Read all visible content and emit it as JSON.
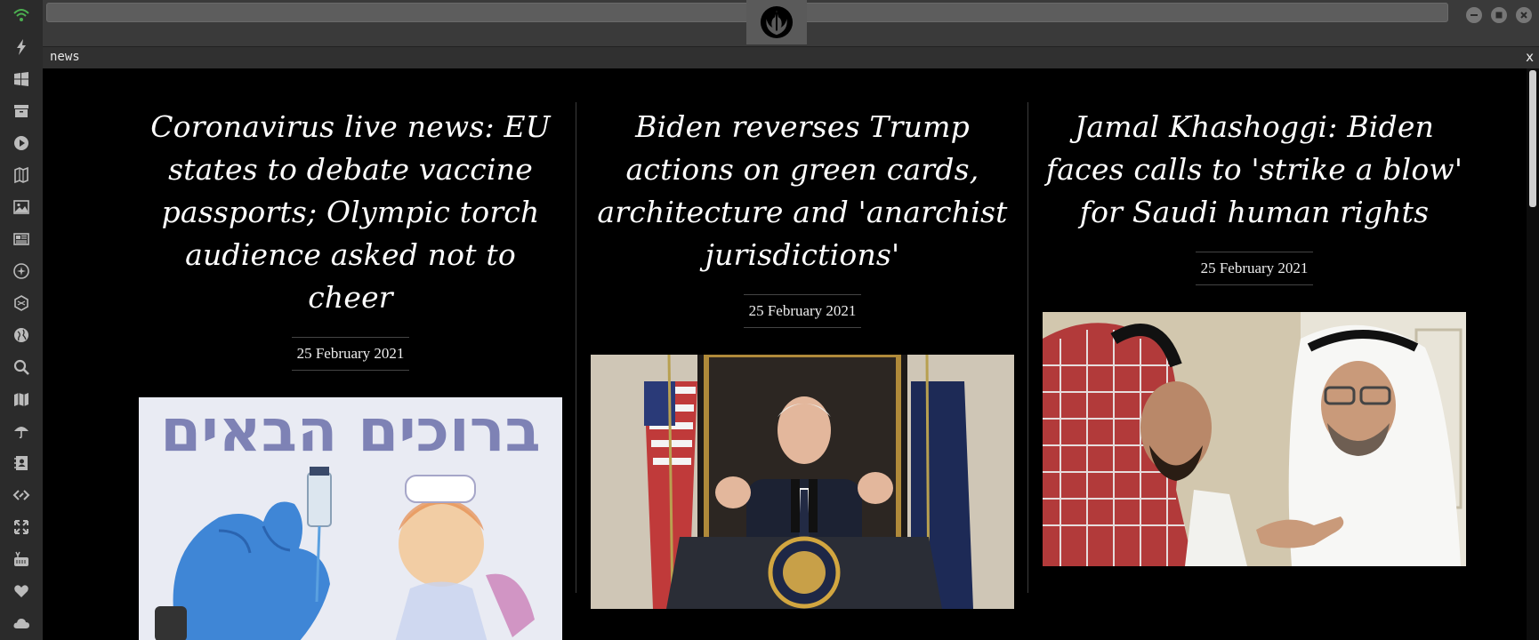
{
  "sidebar": {
    "icons": [
      "wifi-icon",
      "lightning-icon",
      "windows-icon",
      "archive-icon",
      "play-circle-icon",
      "book-map-icon",
      "image-icon",
      "newspaper-icon",
      "rebel-star-icon",
      "hexagon-icon",
      "globe-icon",
      "search-icon",
      "map-icon",
      "umbrella-icon",
      "contacts-icon",
      "code-link-icon",
      "expand-icon",
      "youtube-icon",
      "heart-icon",
      "cloud-icon"
    ],
    "accent": "#4caf50"
  },
  "window": {
    "tab_title": "news",
    "close_label": "x"
  },
  "articles": [
    {
      "headline": "Coronavirus live news: EU states to debate vaccine passports; Olympic torch audience asked not to cheer",
      "date": "25 February 2021",
      "image_desc": "vaccine-photo"
    },
    {
      "headline": "Biden reverses Trump actions on green cards, architecture and 'anarchist jurisdictions'",
      "date": "25 February 2021",
      "image_desc": "biden-photo"
    },
    {
      "headline": "Jamal Khashoggi: Biden faces calls to 'strike a blow' for Saudi human rights",
      "date": "25 February 2021",
      "image_desc": "khashoggi-photo"
    }
  ],
  "vaccine_sign_text": "ברוכים הבאים"
}
